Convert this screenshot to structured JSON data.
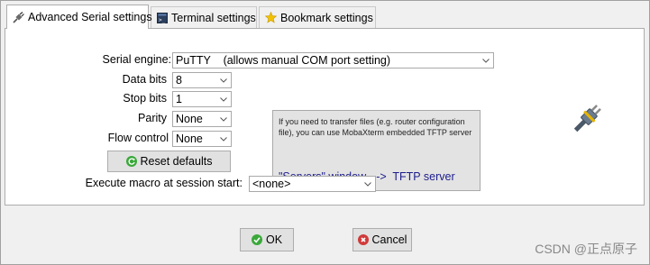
{
  "tabs": [
    {
      "label": "Advanced Serial settings",
      "icon": "serial-plug-icon",
      "active": true
    },
    {
      "label": "Terminal settings",
      "icon": "terminal-icon",
      "active": false
    },
    {
      "label": "Bookmark settings",
      "icon": "star-icon",
      "active": false
    }
  ],
  "form": {
    "serial_engine": {
      "label": "Serial engine:",
      "value": "PuTTY    (allows manual COM port setting)"
    },
    "data_bits": {
      "label": "Data bits",
      "value": "8"
    },
    "stop_bits": {
      "label": "Stop bits",
      "value": "1"
    },
    "parity": {
      "label": "Parity",
      "value": "None"
    },
    "flow_control": {
      "label": "Flow control",
      "value": "None"
    },
    "reset_defaults": {
      "label": "Reset defaults",
      "icon": "reset-icon"
    },
    "execute_macro": {
      "label": "Execute macro at session start:",
      "value": "<none>"
    }
  },
  "info": {
    "text": "If you need to transfer files (e.g. router configuration file), you can use MobaXterm embedded TFTP server",
    "link": "\"Servers\" window  -->  TFTP server"
  },
  "buttons": {
    "ok": {
      "label": "OK",
      "icon": "check-icon"
    },
    "cancel": {
      "label": "Cancel",
      "icon": "cancel-icon"
    }
  },
  "watermark": "CSDN @正点原子",
  "colors": {
    "info_link": "#1c1c8c",
    "ok_icon": "#3aa83a",
    "cancel_icon": "#d03a3a",
    "star": "#f2c200"
  }
}
